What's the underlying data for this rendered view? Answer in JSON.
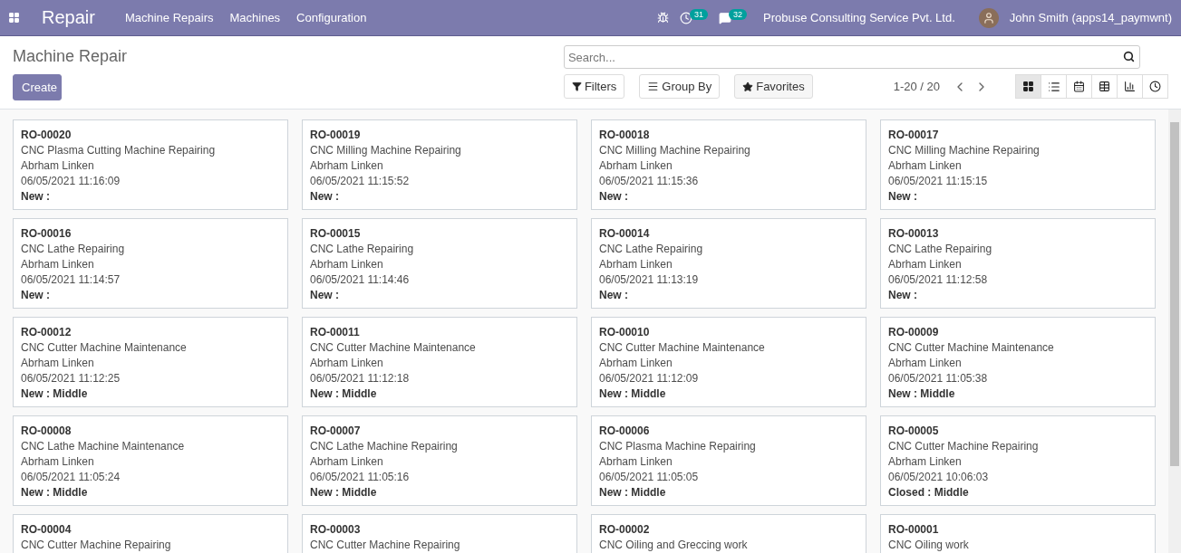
{
  "navbar": {
    "app_title": "Repair",
    "menu": [
      "Machine Repairs",
      "Machines",
      "Configuration"
    ],
    "activity_count": "31",
    "message_count": "32",
    "company": "Probuse Consulting Service Pvt. Ltd.",
    "user": "John Smith (apps14_paymwnt)"
  },
  "control_panel": {
    "breadcrumb": "Machine Repair",
    "create_button": "Create",
    "search": {
      "placeholder": "Search..."
    },
    "filters": [
      {
        "kind": "filter",
        "label": "Filters"
      },
      {
        "kind": "group",
        "label": "Group By"
      },
      {
        "kind": "favorite",
        "label": "Favorites"
      }
    ],
    "pager": "1-20 / 20",
    "views": [
      {
        "kind": "kanban",
        "selected": true
      },
      {
        "kind": "list",
        "selected": false
      },
      {
        "kind": "calendar",
        "selected": false
      },
      {
        "kind": "pivot",
        "selected": false
      },
      {
        "kind": "graph",
        "selected": false
      },
      {
        "kind": "activity",
        "selected": false
      }
    ]
  },
  "cards": [
    {
      "ref": "RO-00020",
      "subject": "CNC Plasma Cutting Machine Repairing",
      "customer": "Abrham Linken",
      "date": "06/05/2021 11:16:09",
      "status": "New :"
    },
    {
      "ref": "RO-00019",
      "subject": "CNC Milling Machine Repairing",
      "customer": "Abrham Linken",
      "date": "06/05/2021 11:15:52",
      "status": "New :"
    },
    {
      "ref": "RO-00018",
      "subject": "CNC Milling Machine Repairing",
      "customer": "Abrham Linken",
      "date": "06/05/2021 11:15:36",
      "status": "New :"
    },
    {
      "ref": "RO-00017",
      "subject": "CNC Milling Machine Repairing",
      "customer": "Abrham Linken",
      "date": "06/05/2021 11:15:15",
      "status": "New :"
    },
    {
      "ref": "RO-00016",
      "subject": "CNC Lathe Repairing",
      "customer": "Abrham Linken",
      "date": "06/05/2021 11:14:57",
      "status": "New :"
    },
    {
      "ref": "RO-00015",
      "subject": "CNC Lathe Repairing",
      "customer": "Abrham Linken",
      "date": "06/05/2021 11:14:46",
      "status": "New :"
    },
    {
      "ref": "RO-00014",
      "subject": "CNC Lathe Repairing",
      "customer": "Abrham Linken",
      "date": "06/05/2021 11:13:19",
      "status": "New :"
    },
    {
      "ref": "RO-00013",
      "subject": "CNC Lathe Repairing",
      "customer": "Abrham Linken",
      "date": "06/05/2021 11:12:58",
      "status": "New :"
    },
    {
      "ref": "RO-00012",
      "subject": "CNC Cutter Machine Maintenance",
      "customer": "Abrham Linken",
      "date": "06/05/2021 11:12:25",
      "status": "New : Middle"
    },
    {
      "ref": "RO-00011",
      "subject": "CNC Cutter Machine Maintenance",
      "customer": "Abrham Linken",
      "date": "06/05/2021 11:12:18",
      "status": "New : Middle"
    },
    {
      "ref": "RO-00010",
      "subject": "CNC Cutter Machine Maintenance",
      "customer": "Abrham Linken",
      "date": "06/05/2021 11:12:09",
      "status": "New : Middle"
    },
    {
      "ref": "RO-00009",
      "subject": "CNC Cutter Machine Maintenance",
      "customer": "Abrham Linken",
      "date": "06/05/2021 11:05:38",
      "status": "New : Middle"
    },
    {
      "ref": "RO-00008",
      "subject": "CNC Lathe Machine Maintenance",
      "customer": "Abrham Linken",
      "date": "06/05/2021 11:05:24",
      "status": "New : Middle"
    },
    {
      "ref": "RO-00007",
      "subject": "CNC Lathe Machine Repairing",
      "customer": "Abrham Linken",
      "date": "06/05/2021 11:05:16",
      "status": "New : Middle"
    },
    {
      "ref": "RO-00006",
      "subject": "CNC Plasma Machine Repairing",
      "customer": "Abrham Linken",
      "date": "06/05/2021 11:05:05",
      "status": "New : Middle"
    },
    {
      "ref": "RO-00005",
      "subject": "CNC Cutter Machine Repairing",
      "customer": "Abrham Linken",
      "date": "06/05/2021 10:06:03",
      "status": "Closed : Middle"
    },
    {
      "ref": "RO-00004",
      "subject": "CNC Cutter Machine Repairing"
    },
    {
      "ref": "RO-00003",
      "subject": "CNC Cutter Machine Repairing"
    },
    {
      "ref": "RO-00002",
      "subject": "CNC Oiling and Greccing work"
    },
    {
      "ref": "RO-00001",
      "subject": "CNC Oiling work"
    }
  ]
}
